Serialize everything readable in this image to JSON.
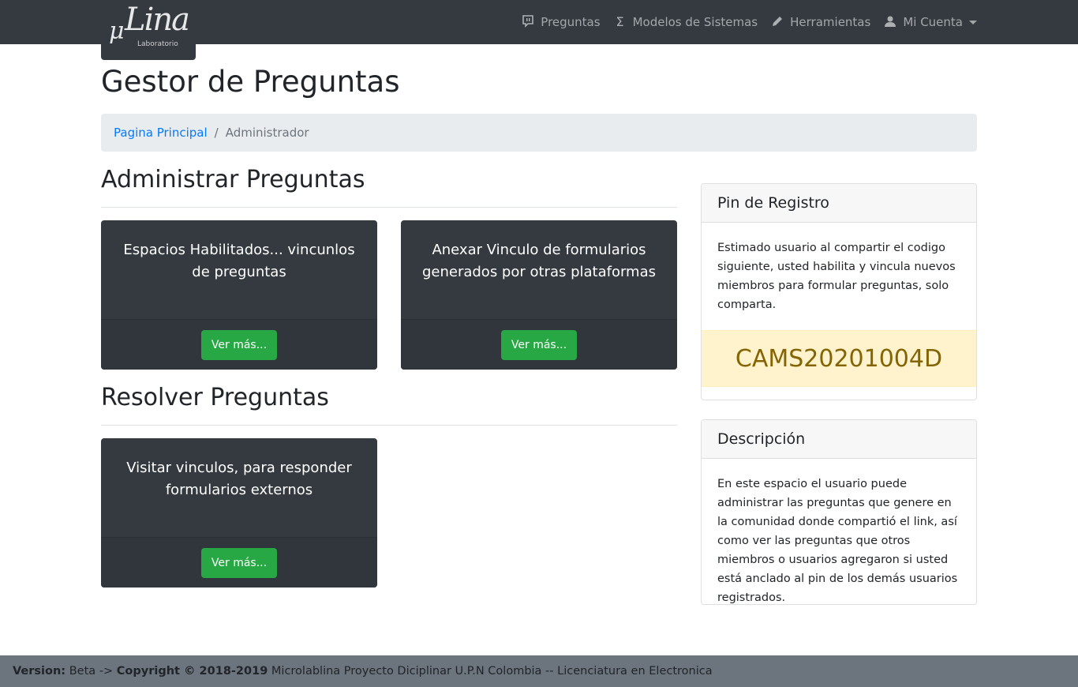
{
  "logo": {
    "mu": "μ",
    "lina": "Lina",
    "sub": "Laboratorio"
  },
  "nav": {
    "items": [
      {
        "icon": "chat-icon",
        "label": "Preguntas"
      },
      {
        "icon": "sigma-icon",
        "label": "Modelos de Sistemas"
      },
      {
        "icon": "pencil-icon",
        "label": "Herramientas"
      },
      {
        "icon": "user-icon",
        "label": "Mi Cuenta"
      }
    ]
  },
  "page": {
    "title": "Gestor de Preguntas"
  },
  "breadcrumb": {
    "home": "Pagina Principal",
    "separator": "/",
    "current": "Administrador"
  },
  "admin": {
    "title": "Administrar Preguntas",
    "cards": [
      {
        "text": "Espacios Habilitados... vincunlos de preguntas",
        "button": "Ver más..."
      },
      {
        "text": "Anexar Vinculo de formularios generados por otras plataformas",
        "button": "Ver más..."
      }
    ]
  },
  "resolve": {
    "title": "Resolver Preguntas",
    "cards": [
      {
        "text": "Visitar vinculos, para responder formularios externos",
        "button": "Ver más..."
      }
    ]
  },
  "pin_card": {
    "header": "Pin de Registro",
    "text": "Estimado usuario al compartir el codigo siguiente, usted habilita y vincula nuevos miembros para formular preguntas, solo comparta.",
    "code": "CAMS20201004D"
  },
  "desc_card": {
    "header": "Descripción",
    "text": "En este espacio el usuario puede administrar las preguntas que genere en la comunidad donde compartió el link, así como ver las preguntas que otros miembros o usuarios agregaron si usted está anclado al pin de los demás usuarios registrados."
  },
  "footer": {
    "version_label": "Version:",
    "version_value": "Beta ->",
    "copyright_label": "Copyright © 2018-2019",
    "copyright_text": "Microlablina Proyecto Diciplinar U.P.N Colombia -- Licenciatura en Electronica"
  },
  "colors": {
    "navbar": "#343a40",
    "success": "#28a745",
    "link": "#007bff",
    "pin_bg": "#fff3cd",
    "pin_text": "#856404",
    "footer": "#6c757d"
  }
}
